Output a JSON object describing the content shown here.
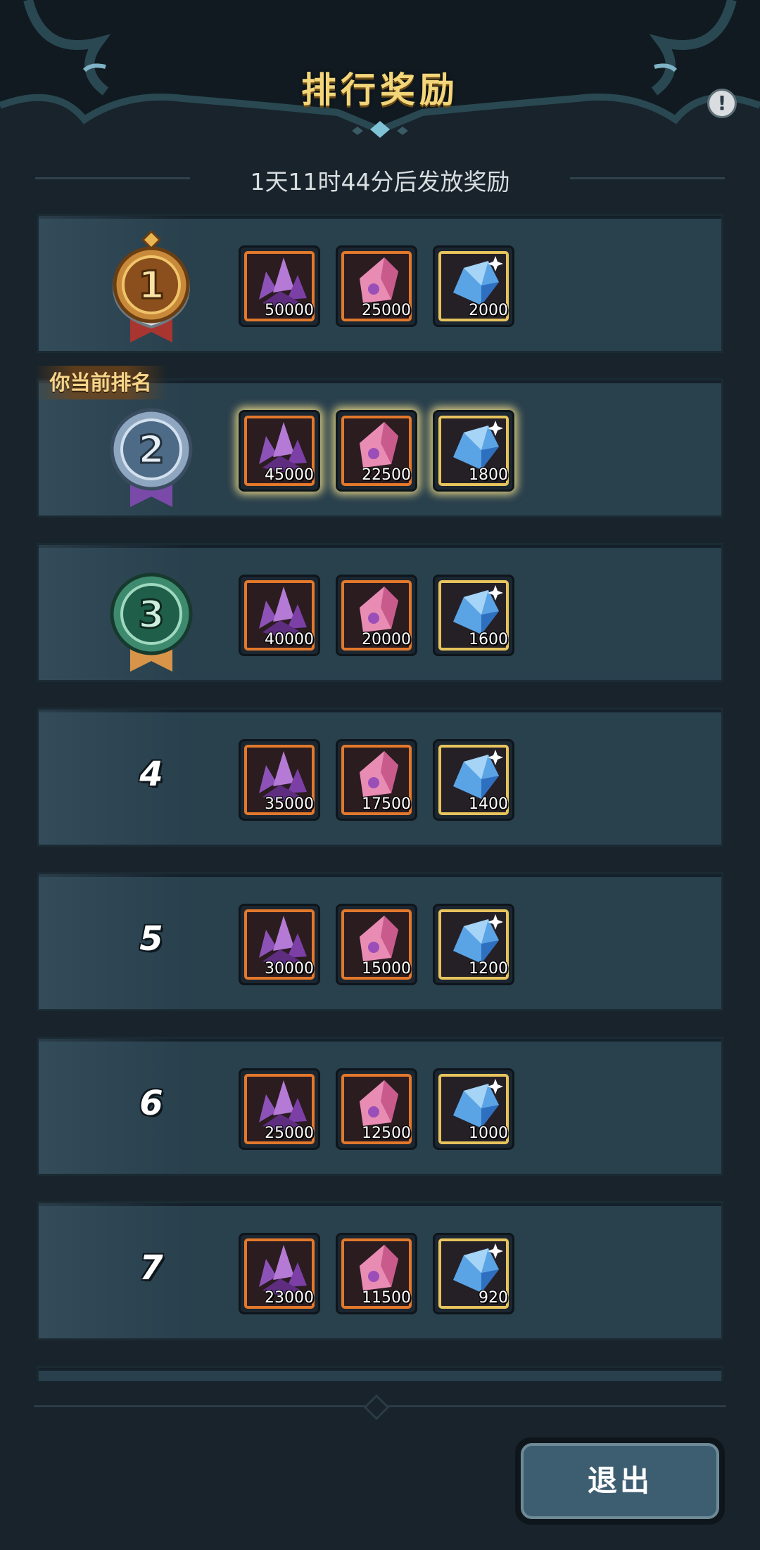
{
  "header": {
    "title": "排行奖励",
    "info_icon": "exclamation-icon",
    "countdown": "1天11时44分后发放奖励"
  },
  "current_rank_tag": "你当前排名",
  "colors": {
    "background": "#18232b",
    "row": "#29404d",
    "title_gold": "#f3d57a",
    "orange_frame": "#e2782b",
    "gold_frame": "#e6c35c"
  },
  "item_icons": [
    "purple-crystal-icon",
    "pink-crystal-icon",
    "blue-crystal-icon"
  ],
  "ranks": [
    {
      "rank": "1",
      "medal": "gold-medal-icon",
      "rewards": [
        "50000",
        "25000",
        "2000"
      ]
    },
    {
      "rank": "2",
      "medal": "silver-medal-icon",
      "rewards": [
        "45000",
        "22500",
        "1800"
      ]
    },
    {
      "rank": "3",
      "medal": "green-medal-icon",
      "rewards": [
        "40000",
        "20000",
        "1600"
      ]
    },
    {
      "rank": "4",
      "rewards": [
        "35000",
        "17500",
        "1400"
      ]
    },
    {
      "rank": "5",
      "rewards": [
        "30000",
        "15000",
        "1200"
      ]
    },
    {
      "rank": "6",
      "rewards": [
        "25000",
        "12500",
        "1000"
      ]
    },
    {
      "rank": "7",
      "rewards": [
        "23000",
        "11500",
        "920"
      ]
    }
  ],
  "footer": {
    "exit_label": "退出"
  }
}
